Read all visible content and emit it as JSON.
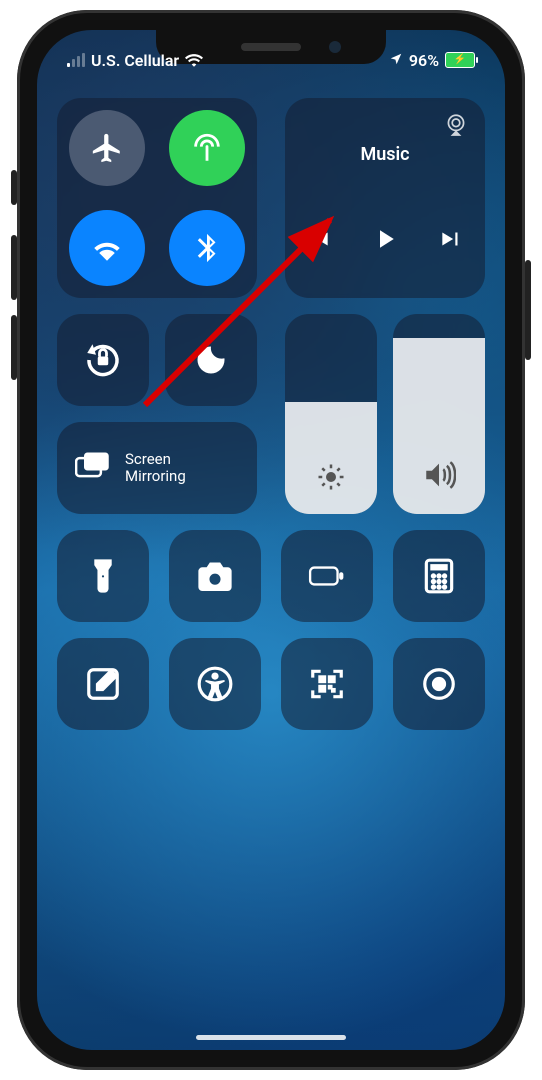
{
  "status": {
    "carrier": "U.S. Cellular",
    "battery_pct": "96%"
  },
  "music": {
    "label": "Music"
  },
  "mirror": {
    "line1": "Screen",
    "line2": "Mirroring"
  },
  "sliders": {
    "brightness_fill": 56,
    "volume_fill": 88
  },
  "annotation": {
    "arrow_color": "#d90000"
  }
}
